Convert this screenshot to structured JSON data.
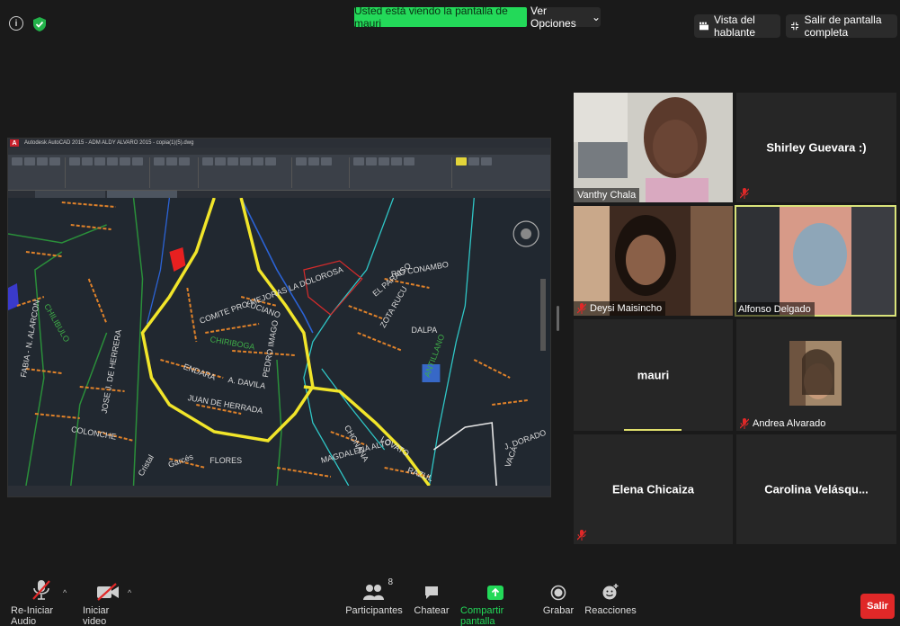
{
  "banner": {
    "text": "Usted está viendo la pantalla de mauri"
  },
  "view_options": {
    "label": "Ver Opciones",
    "caret": "⌄"
  },
  "top_right": {
    "speaker_view": "Vista del hablante",
    "exit_fullscreen": "Salir de pantalla completa"
  },
  "shared_screen": {
    "app_title": "Autodesk AutoCAD 2015 - ADM ALDY ALVARO 2015 - copia(1)(5).dwg",
    "app_logo": "A",
    "street_labels": [
      "LUCIANO",
      "RIO CONAMBO",
      "CHIRIBOGA",
      "COMITE PRO-MEJORAS LA DOLOROSA",
      "EL PARAISO",
      "ENDARA",
      "A. DAVILA",
      "ZOTA RUCU",
      "DALPA",
      "CHILIBULO",
      "JUAN DE HERRADA",
      "PEDRO IMAGO",
      "COLONCHE",
      "FLORES",
      "CHONANA",
      "LOVATO",
      "MAGDALENA ALTO",
      "RAZUL",
      "J. DORADO",
      "FABIA - N. ALARCON",
      "JOSE J. DE HERRERA",
      "Garcés",
      "Cristal",
      "ANTILLANO",
      "VACA"
    ]
  },
  "participants": [
    {
      "name": "Vanthy Chala",
      "muted": false
    },
    {
      "name": "Shirley Guevara :)",
      "muted": true
    },
    {
      "name": "Deysi Maisincho",
      "muted": true
    },
    {
      "name": "Alfonso Delgado",
      "muted": false
    },
    {
      "name": "mauri",
      "muted": false
    },
    {
      "name": "Andrea Alvarado",
      "muted": true
    },
    {
      "name": "Elena Chicaiza",
      "muted": true
    },
    {
      "name": "Carolina  Velásqu...",
      "muted": false
    }
  ],
  "toolbar": {
    "audio_label": "Re-Iniciar Audio",
    "video_label": "Iniciar video",
    "participants_label": "Participantes",
    "participants_count": "8",
    "chat_label": "Chatear",
    "share_label": "Compartir pantalla",
    "record_label": "Grabar",
    "reactions_label": "Reacciones",
    "leave_label": "Salir",
    "caret": "^"
  },
  "colors": {
    "banner_green": "#23d959",
    "share_green": "#23d959",
    "leave_red": "#e02828",
    "active_speaker_outline": "#d9e37a",
    "muted_red": "#e02828"
  }
}
